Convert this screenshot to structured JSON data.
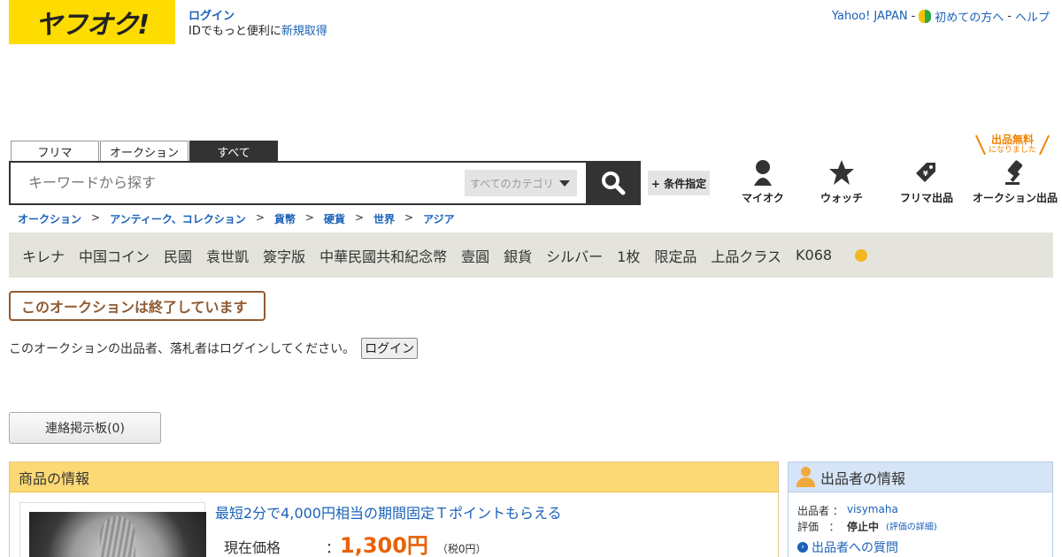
{
  "header": {
    "logo": "ヤフオク!",
    "login_link": "ログイン",
    "signup_prefix": "IDでもっと便利に",
    "signup_link": "新規取得",
    "top_links": {
      "yahoo": "Yahoo! JAPAN",
      "beginners": "初めての方へ",
      "help": "ヘルプ",
      "sep": "-"
    }
  },
  "search": {
    "tabs": [
      "フリマ",
      "オークション",
      "すべて"
    ],
    "active_tab": "すべて",
    "placeholder": "キーワードから探す",
    "category": "すべてのカテゴリ",
    "condition_button": "+ 条件指定"
  },
  "nav": {
    "free_badge": "出品無料",
    "free_badge_sub": "になりました",
    "myauc": "マイオク",
    "watch": "ウォッチ",
    "flea_sell": "フリマ出品",
    "auction_sell": "オークション出品"
  },
  "breadcrumb": [
    "オークション",
    "アンティーク、コレクション",
    "貨幣",
    "硬貨",
    "世界",
    "アジア"
  ],
  "breadcrumb_sep": ">",
  "tags": [
    "キレナ",
    "中国コイン",
    "民國",
    "袁世凱",
    "簽字版",
    "中華民國共和紀念幣",
    "壹圓",
    "銀貨",
    "シルバー",
    "1枚",
    "限定品",
    "上品クラス",
    "K068"
  ],
  "notice": {
    "ended": "このオークションは終了しています",
    "login_message": "このオークションの出品者、落札者はログインしてください。",
    "login_button": "ログイン",
    "board_button": "連絡掲示板(0)"
  },
  "item": {
    "heading": "商品の情報",
    "promo": "最短2分で4,000円相当の期間固定Ｔポイントもらえる",
    "price_label": "現在価格",
    "colon": "：",
    "price": "1,300円",
    "tax": "（税0円）"
  },
  "seller": {
    "heading": "出品者の情報",
    "seller_label": "出品者",
    "colon": "：",
    "seller_name": "visymaha",
    "rating_label": "評価",
    "rating_value": "停止中",
    "rating_detail": "(評価の詳細)",
    "question_link": "出品者への質問"
  },
  "colors": {
    "brand_yellow": "#ffdc00",
    "price_orange": "#e86208",
    "link_blue": "#1a61b9"
  }
}
